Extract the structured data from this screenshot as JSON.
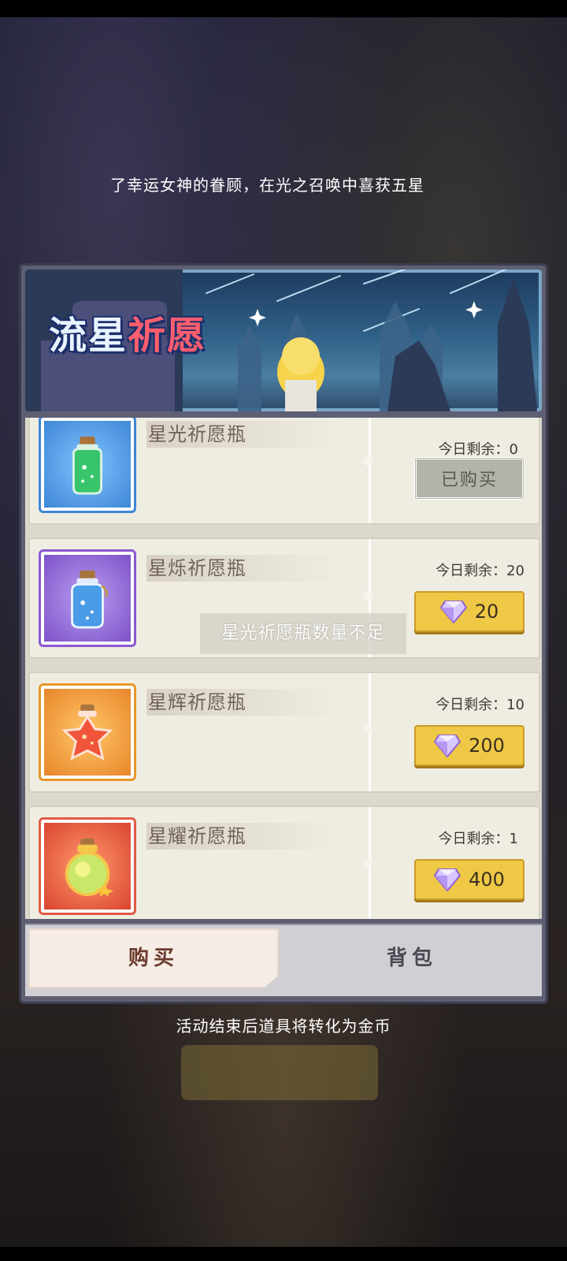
{
  "ticker": {
    "text": "了幸运女神的眷顾，在光之召唤中喜获五星"
  },
  "banner": {
    "title_part1": "流星",
    "title_part2": "祈愿"
  },
  "items": [
    {
      "name": "星光祈愿瓶",
      "remaining_label": "今日剩余：",
      "remaining": "0",
      "state": "purchased",
      "button_label": "已购买",
      "frame_color": "#3d86d6",
      "icon": "green-bottle-icon"
    },
    {
      "name": "星烁祈愿瓶",
      "remaining_label": "今日剩余：",
      "remaining": "20",
      "state": "buy",
      "price": "20",
      "frame_color": "#8a57d2",
      "icon": "blue-bottle-icon"
    },
    {
      "name": "星辉祈愿瓶",
      "remaining_label": "今日剩余：",
      "remaining": "10",
      "state": "buy",
      "price": "200",
      "frame_color": "#e8962a",
      "icon": "star-bottle-icon"
    },
    {
      "name": "星耀祈愿瓶",
      "remaining_label": "今日剩余：",
      "remaining": "1",
      "state": "buy",
      "price": "400",
      "frame_color": "#e25a45",
      "icon": "gold-bottle-icon"
    }
  ],
  "toast": {
    "text": "星光祈愿瓶数量不足"
  },
  "tabs": {
    "buy": "购买",
    "bag": "背包"
  },
  "footnote": "活动结束后道具将转化为金币"
}
